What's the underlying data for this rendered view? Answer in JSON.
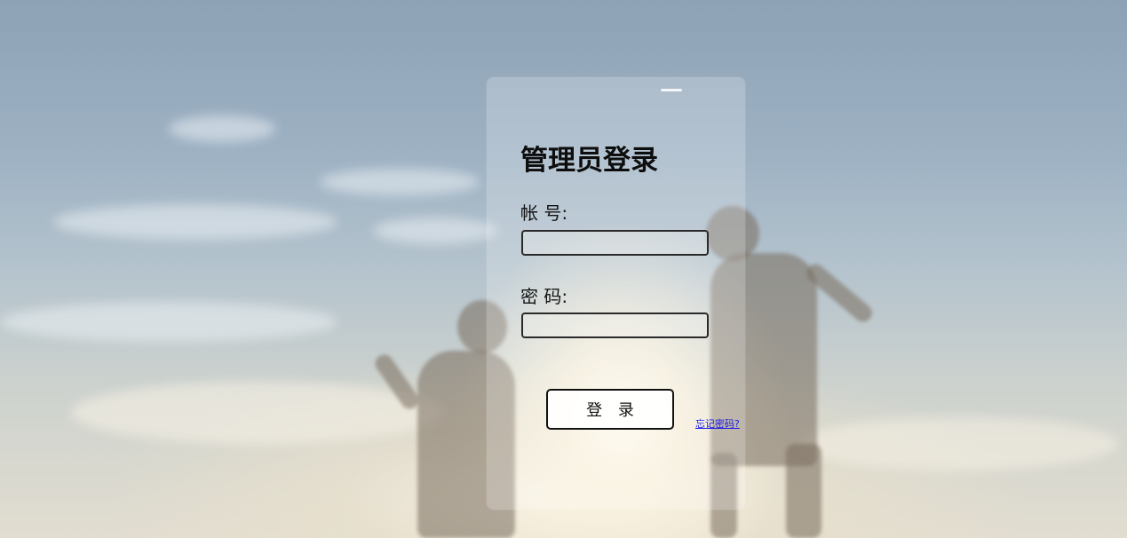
{
  "login": {
    "title": "管理员登录",
    "account_label": "帐 号:",
    "account_value": "",
    "password_label": "密 码:",
    "password_value": "",
    "submit_label": "登 录",
    "forgot_label": "忘记密码?"
  }
}
